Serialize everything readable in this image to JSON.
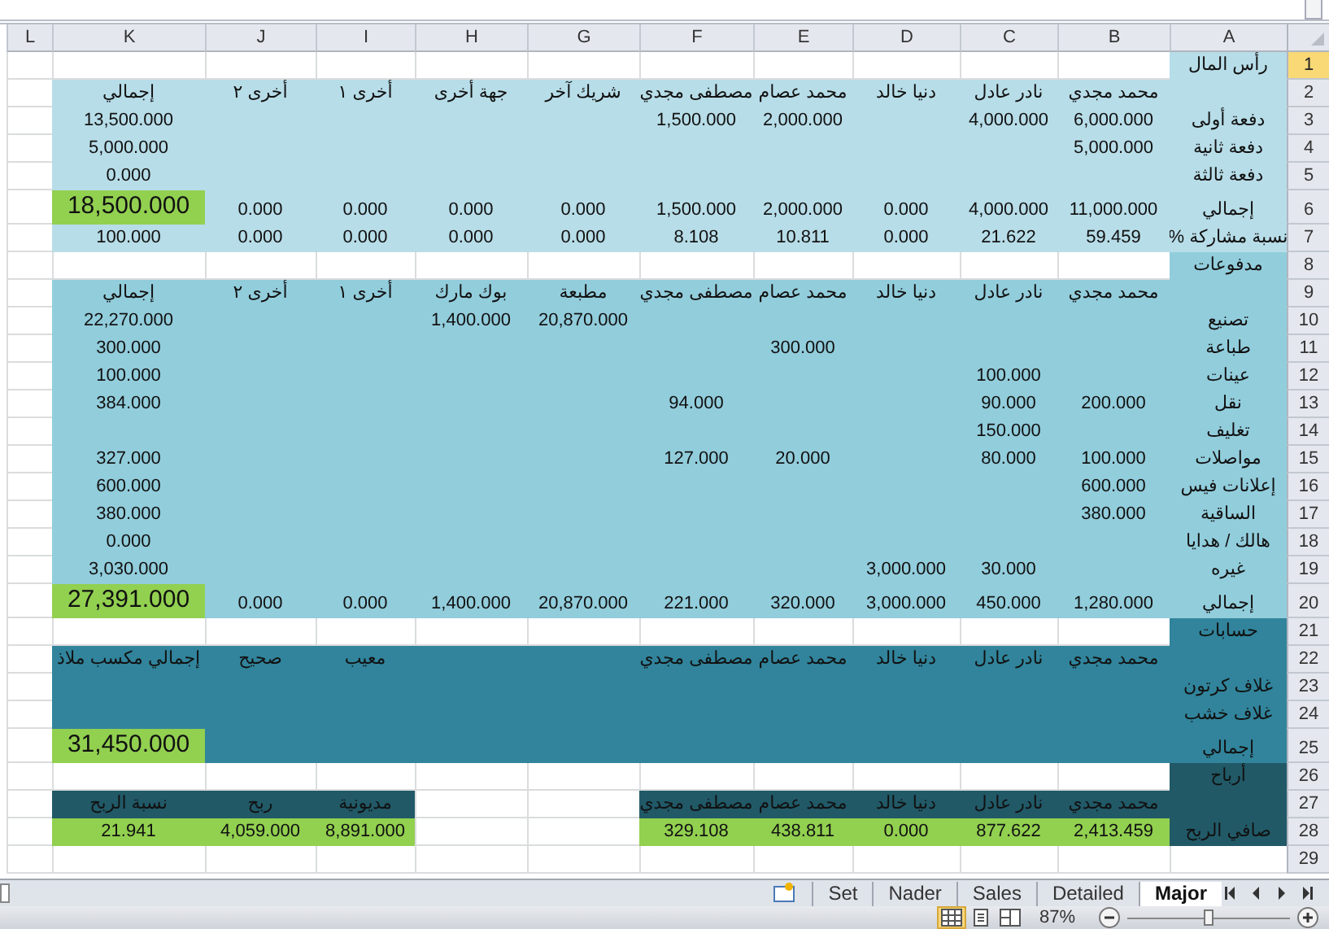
{
  "columns": [
    "A",
    "B",
    "C",
    "D",
    "E",
    "F",
    "G",
    "H",
    "I",
    "J",
    "K",
    "L"
  ],
  "rows": [
    {
      "number": "1",
      "selected": true,
      "cells": [
        {
          "kind": "light",
          "text": "رأس المال"
        },
        {
          "kind": "none"
        },
        {
          "kind": "none"
        },
        {
          "kind": "none"
        },
        {
          "kind": "none"
        },
        {
          "kind": "none"
        },
        {
          "kind": "none"
        },
        {
          "kind": "none"
        },
        {
          "kind": "none"
        },
        {
          "kind": "none"
        },
        {
          "kind": "none"
        },
        {
          "kind": "none"
        }
      ]
    },
    {
      "number": "2",
      "selected": false,
      "cells": [
        {
          "kind": "light"
        },
        {
          "kind": "light",
          "text": "محمد مجدي"
        },
        {
          "kind": "light",
          "text": "نادر عادل"
        },
        {
          "kind": "light",
          "text": "دنيا خالد"
        },
        {
          "kind": "light",
          "text": "محمد عصام"
        },
        {
          "kind": "light",
          "text": "مصطفى مجدي"
        },
        {
          "kind": "light",
          "text": "شريك آخر"
        },
        {
          "kind": "light",
          "text": "جهة أخرى"
        },
        {
          "kind": "light",
          "text": "أخرى ١"
        },
        {
          "kind": "light",
          "text": "أخرى ٢"
        },
        {
          "kind": "light",
          "text": "إجمالي"
        },
        {
          "kind": "none"
        }
      ]
    },
    {
      "number": "3",
      "selected": false,
      "cells": [
        {
          "kind": "light",
          "text": "دفعة أولى"
        },
        {
          "kind": "light",
          "text": "6,000.000"
        },
        {
          "kind": "light",
          "text": "4,000.000"
        },
        {
          "kind": "light"
        },
        {
          "kind": "light",
          "text": "2,000.000"
        },
        {
          "kind": "light",
          "text": "1,500.000"
        },
        {
          "kind": "light"
        },
        {
          "kind": "light"
        },
        {
          "kind": "light"
        },
        {
          "kind": "light"
        },
        {
          "kind": "light",
          "text": "13,500.000"
        },
        {
          "kind": "none"
        }
      ]
    },
    {
      "number": "4",
      "selected": false,
      "cells": [
        {
          "kind": "light",
          "text": "دفعة ثانية"
        },
        {
          "kind": "light",
          "text": "5,000.000"
        },
        {
          "kind": "light"
        },
        {
          "kind": "light"
        },
        {
          "kind": "light"
        },
        {
          "kind": "light"
        },
        {
          "kind": "light"
        },
        {
          "kind": "light"
        },
        {
          "kind": "light"
        },
        {
          "kind": "light"
        },
        {
          "kind": "light",
          "text": "5,000.000"
        },
        {
          "kind": "none"
        }
      ]
    },
    {
      "number": "5",
      "selected": false,
      "cells": [
        {
          "kind": "light",
          "text": "دفعة ثالثة"
        },
        {
          "kind": "light"
        },
        {
          "kind": "light"
        },
        {
          "kind": "light"
        },
        {
          "kind": "light"
        },
        {
          "kind": "light"
        },
        {
          "kind": "light"
        },
        {
          "kind": "light"
        },
        {
          "kind": "light"
        },
        {
          "kind": "light"
        },
        {
          "kind": "light",
          "text": "0.000"
        },
        {
          "kind": "none"
        }
      ]
    },
    {
      "number": "6",
      "selected": false,
      "cells": [
        {
          "kind": "light",
          "text": "إجمالي"
        },
        {
          "kind": "light",
          "text": "11,000.000"
        },
        {
          "kind": "light",
          "text": "4,000.000"
        },
        {
          "kind": "light",
          "text": "0.000"
        },
        {
          "kind": "light",
          "text": "2,000.000"
        },
        {
          "kind": "light",
          "text": "1,500.000"
        },
        {
          "kind": "light",
          "text": "0.000"
        },
        {
          "kind": "light",
          "text": "0.000"
        },
        {
          "kind": "light",
          "text": "0.000"
        },
        {
          "kind": "light",
          "text": "0.000"
        },
        {
          "kind": "green",
          "text": "18,500.000"
        },
        {
          "kind": "none"
        }
      ]
    },
    {
      "number": "7",
      "selected": false,
      "cells": [
        {
          "kind": "light",
          "text": "نسبة مشاركة %"
        },
        {
          "kind": "light",
          "text": "59.459"
        },
        {
          "kind": "light",
          "text": "21.622"
        },
        {
          "kind": "light",
          "text": "0.000"
        },
        {
          "kind": "light",
          "text": "10.811"
        },
        {
          "kind": "light",
          "text": "8.108"
        },
        {
          "kind": "light",
          "text": "0.000"
        },
        {
          "kind": "light",
          "text": "0.000"
        },
        {
          "kind": "light",
          "text": "0.000"
        },
        {
          "kind": "light",
          "text": "0.000"
        },
        {
          "kind": "light",
          "text": "100.000"
        },
        {
          "kind": "none"
        }
      ]
    },
    {
      "number": "8",
      "selected": false,
      "cells": [
        {
          "kind": "mid",
          "text": "مدفوعات"
        },
        {
          "kind": "none"
        },
        {
          "kind": "none"
        },
        {
          "kind": "none"
        },
        {
          "kind": "none"
        },
        {
          "kind": "none"
        },
        {
          "kind": "none"
        },
        {
          "kind": "none"
        },
        {
          "kind": "none"
        },
        {
          "kind": "none"
        },
        {
          "kind": "none"
        },
        {
          "kind": "none"
        }
      ]
    },
    {
      "number": "9",
      "selected": false,
      "cells": [
        {
          "kind": "mid"
        },
        {
          "kind": "mid",
          "text": "محمد مجدي"
        },
        {
          "kind": "mid",
          "text": "نادر عادل"
        },
        {
          "kind": "mid",
          "text": "دنيا خالد"
        },
        {
          "kind": "mid",
          "text": "محمد عصام"
        },
        {
          "kind": "mid",
          "text": "مصطفى مجدي"
        },
        {
          "kind": "mid",
          "text": "مطبعة"
        },
        {
          "kind": "mid",
          "text": "بوك مارك"
        },
        {
          "kind": "mid",
          "text": "أخرى ١"
        },
        {
          "kind": "mid",
          "text": "أخرى ٢"
        },
        {
          "kind": "mid",
          "text": "إجمالي"
        },
        {
          "kind": "none"
        }
      ]
    },
    {
      "number": "10",
      "selected": false,
      "cells": [
        {
          "kind": "mid",
          "text": "تصنيع"
        },
        {
          "kind": "mid"
        },
        {
          "kind": "mid"
        },
        {
          "kind": "mid"
        },
        {
          "kind": "mid"
        },
        {
          "kind": "mid"
        },
        {
          "kind": "mid",
          "text": "20,870.000"
        },
        {
          "kind": "mid",
          "text": "1,400.000"
        },
        {
          "kind": "mid"
        },
        {
          "kind": "mid"
        },
        {
          "kind": "mid",
          "text": "22,270.000"
        },
        {
          "kind": "none"
        }
      ]
    },
    {
      "number": "11",
      "selected": false,
      "cells": [
        {
          "kind": "mid",
          "text": "طباعة"
        },
        {
          "kind": "mid"
        },
        {
          "kind": "mid"
        },
        {
          "kind": "mid"
        },
        {
          "kind": "mid",
          "text": "300.000"
        },
        {
          "kind": "mid"
        },
        {
          "kind": "mid"
        },
        {
          "kind": "mid"
        },
        {
          "kind": "mid"
        },
        {
          "kind": "mid"
        },
        {
          "kind": "mid",
          "text": "300.000"
        },
        {
          "kind": "none"
        }
      ]
    },
    {
      "number": "12",
      "selected": false,
      "cells": [
        {
          "kind": "mid",
          "text": "عينات"
        },
        {
          "kind": "mid"
        },
        {
          "kind": "mid",
          "text": "100.000"
        },
        {
          "kind": "mid"
        },
        {
          "kind": "mid"
        },
        {
          "kind": "mid"
        },
        {
          "kind": "mid"
        },
        {
          "kind": "mid"
        },
        {
          "kind": "mid"
        },
        {
          "kind": "mid"
        },
        {
          "kind": "mid",
          "text": "100.000"
        },
        {
          "kind": "none"
        }
      ]
    },
    {
      "number": "13",
      "selected": false,
      "cells": [
        {
          "kind": "mid",
          "text": "نقل"
        },
        {
          "kind": "mid",
          "text": "200.000"
        },
        {
          "kind": "mid",
          "text": "90.000"
        },
        {
          "kind": "mid"
        },
        {
          "kind": "mid"
        },
        {
          "kind": "mid",
          "text": "94.000"
        },
        {
          "kind": "mid"
        },
        {
          "kind": "mid"
        },
        {
          "kind": "mid"
        },
        {
          "kind": "mid"
        },
        {
          "kind": "mid",
          "text": "384.000"
        },
        {
          "kind": "none"
        }
      ]
    },
    {
      "number": "14",
      "selected": false,
      "cells": [
        {
          "kind": "mid",
          "text": "تغليف"
        },
        {
          "kind": "mid"
        },
        {
          "kind": "mid",
          "text": "150.000"
        },
        {
          "kind": "mid"
        },
        {
          "kind": "mid"
        },
        {
          "kind": "mid"
        },
        {
          "kind": "mid"
        },
        {
          "kind": "mid"
        },
        {
          "kind": "mid"
        },
        {
          "kind": "mid"
        },
        {
          "kind": "mid"
        },
        {
          "kind": "none"
        }
      ]
    },
    {
      "number": "15",
      "selected": false,
      "cells": [
        {
          "kind": "mid",
          "text": "مواصلات"
        },
        {
          "kind": "mid",
          "text": "100.000"
        },
        {
          "kind": "mid",
          "text": "80.000"
        },
        {
          "kind": "mid"
        },
        {
          "kind": "mid",
          "text": "20.000"
        },
        {
          "kind": "mid",
          "text": "127.000"
        },
        {
          "kind": "mid"
        },
        {
          "kind": "mid"
        },
        {
          "kind": "mid"
        },
        {
          "kind": "mid"
        },
        {
          "kind": "mid",
          "text": "327.000"
        },
        {
          "kind": "none"
        }
      ]
    },
    {
      "number": "16",
      "selected": false,
      "cells": [
        {
          "kind": "mid",
          "text": "إعلانات فيس"
        },
        {
          "kind": "mid",
          "text": "600.000"
        },
        {
          "kind": "mid"
        },
        {
          "kind": "mid"
        },
        {
          "kind": "mid"
        },
        {
          "kind": "mid"
        },
        {
          "kind": "mid"
        },
        {
          "kind": "mid"
        },
        {
          "kind": "mid"
        },
        {
          "kind": "mid"
        },
        {
          "kind": "mid",
          "text": "600.000"
        },
        {
          "kind": "none"
        }
      ]
    },
    {
      "number": "17",
      "selected": false,
      "cells": [
        {
          "kind": "mid",
          "text": "الساقية"
        },
        {
          "kind": "mid",
          "text": "380.000"
        },
        {
          "kind": "mid"
        },
        {
          "kind": "mid"
        },
        {
          "kind": "mid"
        },
        {
          "kind": "mid"
        },
        {
          "kind": "mid"
        },
        {
          "kind": "mid"
        },
        {
          "kind": "mid"
        },
        {
          "kind": "mid"
        },
        {
          "kind": "mid",
          "text": "380.000"
        },
        {
          "kind": "none"
        }
      ]
    },
    {
      "number": "18",
      "selected": false,
      "cells": [
        {
          "kind": "mid",
          "text": "هالك / هدايا"
        },
        {
          "kind": "mid"
        },
        {
          "kind": "mid"
        },
        {
          "kind": "mid"
        },
        {
          "kind": "mid"
        },
        {
          "kind": "mid"
        },
        {
          "kind": "mid"
        },
        {
          "kind": "mid"
        },
        {
          "kind": "mid"
        },
        {
          "kind": "mid"
        },
        {
          "kind": "mid",
          "text": "0.000"
        },
        {
          "kind": "none"
        }
      ]
    },
    {
      "number": "19",
      "selected": false,
      "cells": [
        {
          "kind": "mid",
          "text": "غيره"
        },
        {
          "kind": "mid"
        },
        {
          "kind": "mid",
          "text": "30.000"
        },
        {
          "kind": "mid",
          "text": "3,000.000"
        },
        {
          "kind": "mid"
        },
        {
          "kind": "mid"
        },
        {
          "kind": "mid"
        },
        {
          "kind": "mid"
        },
        {
          "kind": "mid"
        },
        {
          "kind": "mid"
        },
        {
          "kind": "mid",
          "text": "3,030.000"
        },
        {
          "kind": "none"
        }
      ]
    },
    {
      "number": "20",
      "selected": false,
      "cells": [
        {
          "kind": "mid",
          "text": "إجمالي"
        },
        {
          "kind": "mid",
          "text": "1,280.000"
        },
        {
          "kind": "mid",
          "text": "450.000"
        },
        {
          "kind": "mid",
          "text": "3,000.000"
        },
        {
          "kind": "mid",
          "text": "320.000"
        },
        {
          "kind": "mid",
          "text": "221.000"
        },
        {
          "kind": "mid",
          "text": "20,870.000"
        },
        {
          "kind": "mid",
          "text": "1,400.000"
        },
        {
          "kind": "mid",
          "text": "0.000"
        },
        {
          "kind": "mid",
          "text": "0.000"
        },
        {
          "kind": "green",
          "text": "27,391.000"
        },
        {
          "kind": "none"
        }
      ]
    },
    {
      "number": "21",
      "selected": false,
      "cells": [
        {
          "kind": "dark",
          "text": "حسابات"
        },
        {
          "kind": "none"
        },
        {
          "kind": "none"
        },
        {
          "kind": "none"
        },
        {
          "kind": "none"
        },
        {
          "kind": "none"
        },
        {
          "kind": "none"
        },
        {
          "kind": "none"
        },
        {
          "kind": "none"
        },
        {
          "kind": "none"
        },
        {
          "kind": "none"
        },
        {
          "kind": "none"
        }
      ]
    },
    {
      "number": "22",
      "selected": false,
      "cells": [
        {
          "kind": "dark"
        },
        {
          "kind": "dark",
          "text": "محمد مجدي"
        },
        {
          "kind": "dark",
          "text": "نادر عادل"
        },
        {
          "kind": "dark",
          "text": "دنيا خالد"
        },
        {
          "kind": "dark",
          "text": "محمد عصام"
        },
        {
          "kind": "dark",
          "text": "مصطفى مجدي"
        },
        {
          "kind": "dark"
        },
        {
          "kind": "dark"
        },
        {
          "kind": "dark",
          "text": "معيب"
        },
        {
          "kind": "dark",
          "text": "صحيح"
        },
        {
          "kind": "dark",
          "text": "إجمالي مكسب ملاذ"
        },
        {
          "kind": "none"
        }
      ]
    },
    {
      "number": "23",
      "selected": false,
      "cells": [
        {
          "kind": "dark",
          "text": "غلاف كرتون"
        },
        {
          "kind": "dark"
        },
        {
          "kind": "dark"
        },
        {
          "kind": "dark"
        },
        {
          "kind": "dark"
        },
        {
          "kind": "dark"
        },
        {
          "kind": "dark"
        },
        {
          "kind": "dark"
        },
        {
          "kind": "dark"
        },
        {
          "kind": "dark"
        },
        {
          "kind": "dark"
        },
        {
          "kind": "none"
        }
      ]
    },
    {
      "number": "24",
      "selected": false,
      "cells": [
        {
          "kind": "dark",
          "text": "غلاف خشب"
        },
        {
          "kind": "dark"
        },
        {
          "kind": "dark"
        },
        {
          "kind": "dark"
        },
        {
          "kind": "dark"
        },
        {
          "kind": "dark"
        },
        {
          "kind": "dark"
        },
        {
          "kind": "dark"
        },
        {
          "kind": "dark"
        },
        {
          "kind": "dark"
        },
        {
          "kind": "dark"
        },
        {
          "kind": "none"
        }
      ]
    },
    {
      "number": "25",
      "selected": false,
      "cells": [
        {
          "kind": "dark",
          "text": "إجمالي"
        },
        {
          "kind": "dark"
        },
        {
          "kind": "dark"
        },
        {
          "kind": "dark"
        },
        {
          "kind": "dark"
        },
        {
          "kind": "dark"
        },
        {
          "kind": "dark"
        },
        {
          "kind": "dark"
        },
        {
          "kind": "dark"
        },
        {
          "kind": "dark"
        },
        {
          "kind": "green",
          "text": "31,450.000"
        },
        {
          "kind": "none"
        }
      ]
    },
    {
      "number": "26",
      "selected": false,
      "cells": [
        {
          "kind": "darkest",
          "text": "أرباح"
        },
        {
          "kind": "none"
        },
        {
          "kind": "none"
        },
        {
          "kind": "none"
        },
        {
          "kind": "none"
        },
        {
          "kind": "none"
        },
        {
          "kind": "none"
        },
        {
          "kind": "none"
        },
        {
          "kind": "none"
        },
        {
          "kind": "none"
        },
        {
          "kind": "none"
        },
        {
          "kind": "none"
        }
      ]
    },
    {
      "number": "27",
      "selected": false,
      "cells": [
        {
          "kind": "darkest"
        },
        {
          "kind": "darkest",
          "text": "محمد مجدي"
        },
        {
          "kind": "darkest",
          "text": "نادر عادل"
        },
        {
          "kind": "darkest",
          "text": "دنيا خالد"
        },
        {
          "kind": "darkest",
          "text": "محمد عصام"
        },
        {
          "kind": "darkest",
          "text": "مصطفى مجدي"
        },
        {
          "kind": "none"
        },
        {
          "kind": "none"
        },
        {
          "kind": "darkest",
          "text": "مديونية"
        },
        {
          "kind": "darkest",
          "text": "ربح"
        },
        {
          "kind": "darkest",
          "text": "نسبة الربح"
        },
        {
          "kind": "none"
        }
      ]
    },
    {
      "number": "28",
      "selected": false,
      "cells": [
        {
          "kind": "darkest",
          "text": "صافي الربح"
        },
        {
          "kind": "green",
          "text": "2,413.459"
        },
        {
          "kind": "green",
          "text": "877.622"
        },
        {
          "kind": "green",
          "text": "0.000"
        },
        {
          "kind": "green",
          "text": "438.811"
        },
        {
          "kind": "green",
          "text": "329.108"
        },
        {
          "kind": "none"
        },
        {
          "kind": "none"
        },
        {
          "kind": "green",
          "text": "8,891.000"
        },
        {
          "kind": "green",
          "text": "4,059.000"
        },
        {
          "kind": "green",
          "text": "21.941"
        },
        {
          "kind": "none"
        }
      ]
    },
    {
      "number": "29",
      "selected": false,
      "cells": [
        {
          "kind": "none"
        },
        {
          "kind": "none"
        },
        {
          "kind": "none"
        },
        {
          "kind": "none"
        },
        {
          "kind": "none"
        },
        {
          "kind": "none"
        },
        {
          "kind": "none"
        },
        {
          "kind": "none"
        },
        {
          "kind": "none"
        },
        {
          "kind": "none"
        },
        {
          "kind": "none"
        },
        {
          "kind": "none"
        }
      ]
    }
  ],
  "sheet_tabs": [
    {
      "label": "Major",
      "selected": true
    },
    {
      "label": "Detailed",
      "selected": false
    },
    {
      "label": "Sales",
      "selected": false
    },
    {
      "label": "Nader",
      "selected": false
    },
    {
      "label": "Set",
      "selected": false
    }
  ],
  "status_bar": {
    "views": [
      {
        "kind": "normal",
        "selected": true
      },
      {
        "kind": "page_layout",
        "selected": false
      },
      {
        "kind": "page_break",
        "selected": false
      }
    ],
    "zoom": "87%",
    "zoom_slider": {
      "level": 0.5
    }
  }
}
